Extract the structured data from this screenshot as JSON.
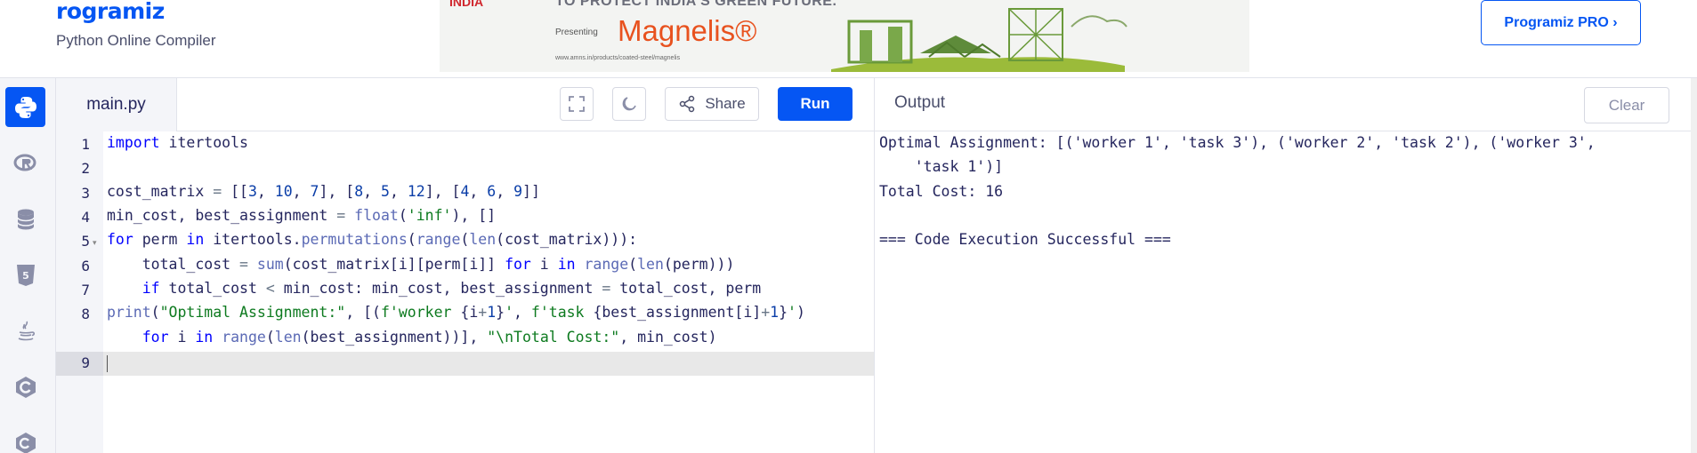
{
  "header": {
    "logo_text": "rogramiz",
    "subtitle": "Python Online Compiler",
    "ad": {
      "tag": "INDIA",
      "headline": "TO PROTECT INDIA'S GREEN FUTURE.",
      "presenting": "Presenting",
      "brand": "Magnelis®",
      "url": "www.amns.in/products/coated-steel/magnelis"
    },
    "pro_button": "Programiz PRO ›"
  },
  "sidebar": {
    "languages": [
      "python-icon",
      "r-icon",
      "sql-icon",
      "html-icon",
      "java-icon",
      "c-icon",
      "cpp-icon"
    ],
    "accent": "#0556f3"
  },
  "editor": {
    "file_name": "main.py",
    "share_label": "Share",
    "run_label": "Run",
    "line_numbers": [
      "1",
      "2",
      "3",
      "4",
      "5",
      "6",
      "7",
      "8",
      "",
      "9"
    ],
    "lines": [
      "import itertools",
      "",
      "cost_matrix = [[3, 10, 7], [8, 5, 12], [4, 6, 9]]",
      "min_cost, best_assignment = float('inf'), []",
      "for perm in itertools.permutations(range(len(cost_matrix))):",
      "    total_cost = sum(cost_matrix[i][perm[i]] for i in range(len(perm)))",
      "    if total_cost < min_cost: min_cost, best_assignment = total_cost, perm",
      "print(\"Optimal Assignment:\", [(f'worker {i+1}', f'task {best_assignment[i]+1}')",
      "    for i in range(len(best_assignment))], \"\\nTotal Cost:\", min_cost)",
      ""
    ]
  },
  "output": {
    "title": "Output",
    "clear_label": "Clear",
    "lines": [
      "Optimal Assignment: [('worker 1', 'task 3'), ('worker 2', 'task 2'), ('worker 3',",
      "    'task 1')]",
      "Total Cost: 16",
      "",
      "=== Code Execution Successful ==="
    ]
  }
}
